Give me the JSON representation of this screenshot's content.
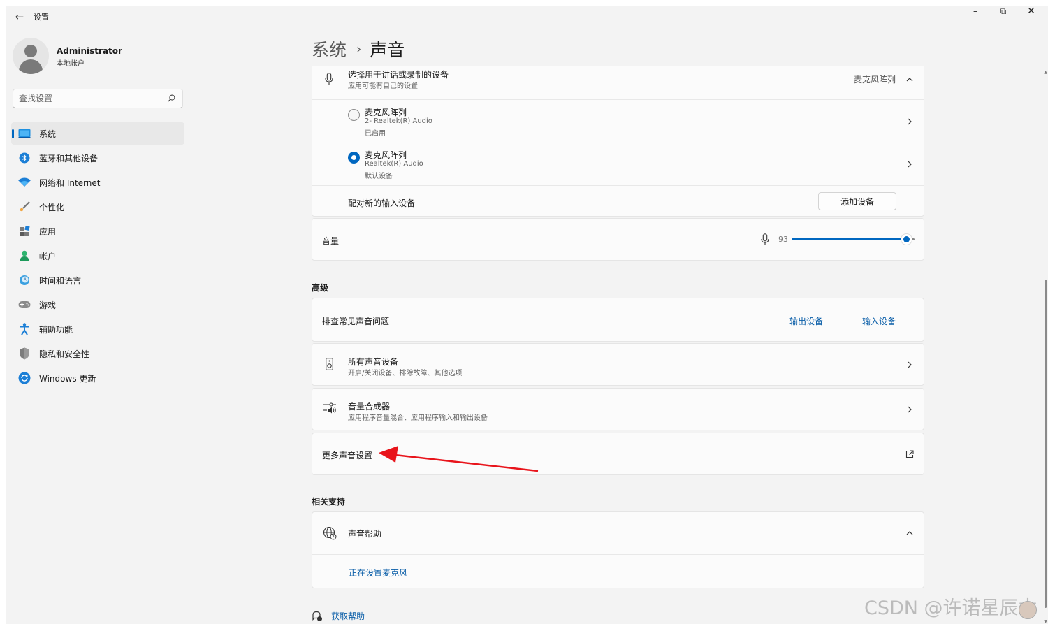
{
  "window": {
    "app_title": "设置",
    "back_glyph": "←",
    "minimize_glyph": "–",
    "maximize_glyph": "⧉",
    "close_glyph": "✕"
  },
  "user": {
    "name": "Administrator",
    "account_type": "本地帐户"
  },
  "search": {
    "placeholder": "查找设置"
  },
  "sidebar": {
    "items": [
      {
        "label": "系统",
        "icon": "system-icon",
        "active": true
      },
      {
        "label": "蓝牙和其他设备",
        "icon": "bluetooth-icon"
      },
      {
        "label": "网络和 Internet",
        "icon": "wifi-icon"
      },
      {
        "label": "个性化",
        "icon": "brush-icon"
      },
      {
        "label": "应用",
        "icon": "apps-icon"
      },
      {
        "label": "帐户",
        "icon": "account-icon"
      },
      {
        "label": "时间和语言",
        "icon": "time-language-icon"
      },
      {
        "label": "游戏",
        "icon": "gamepad-icon"
      },
      {
        "label": "辅助功能",
        "icon": "accessibility-icon"
      },
      {
        "label": "隐私和安全性",
        "icon": "shield-icon"
      },
      {
        "label": "Windows 更新",
        "icon": "windows-update-icon"
      }
    ]
  },
  "breadcrumb": {
    "parent": "系统",
    "separator": "›",
    "current": "声音"
  },
  "input": {
    "title": "选择用于讲话或录制的设备",
    "subtitle": "应用可能有自己的设置",
    "selected": "麦克风阵列",
    "devices": [
      {
        "name": "麦克风阵列",
        "driver": "2- Realtek(R) Audio",
        "status": "已启用",
        "selected": false
      },
      {
        "name": "麦克风阵列",
        "driver": "Realtek(R) Audio",
        "status": "默认设备",
        "selected": true
      }
    ],
    "pair_label": "配对新的输入设备",
    "add_button": "添加设备"
  },
  "volume": {
    "label": "音量",
    "value": "93",
    "level": 0.93
  },
  "advanced": {
    "heading": "高级",
    "troubleshoot_label": "排查常见声音问题",
    "output_link": "输出设备",
    "input_link": "输入设备",
    "all_devices_title": "所有声音设备",
    "all_devices_sub": "开启/关闭设备、排除故障、其他选项",
    "mixer_title": "音量合成器",
    "mixer_sub": "应用程序音量混合、应用程序输入和输出设备",
    "more_settings": "更多声音设置"
  },
  "support": {
    "heading": "相关支持",
    "help_title": "声音帮助",
    "help_link": "正在设置麦克风"
  },
  "get_help": "获取帮助",
  "watermark": "CSDN @许诺星辰木",
  "colors": {
    "accent": "#0067c0",
    "annotation_arrow": "#e8141b"
  }
}
